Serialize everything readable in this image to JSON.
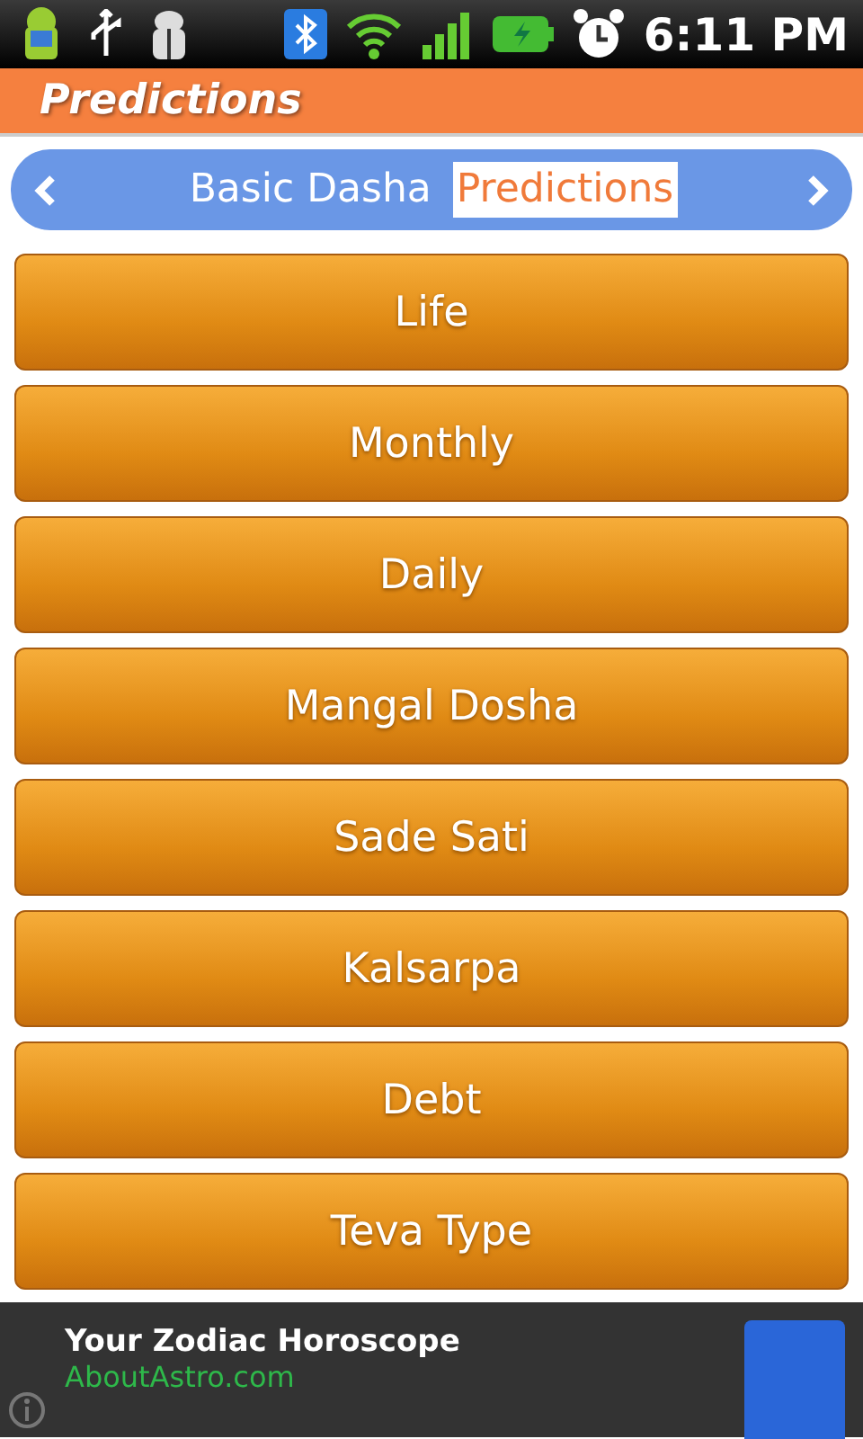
{
  "status_bar": {
    "time": "6:11 PM"
  },
  "header": {
    "title": "Predictions"
  },
  "tabs": [
    {
      "label": "Basic Dasha",
      "selected": false
    },
    {
      "label": "Predictions",
      "selected": true
    }
  ],
  "menu": [
    "Life",
    "Monthly",
    "Daily",
    "Mangal Dosha",
    "Sade Sati",
    "Kalsarpa",
    "Debt",
    "Teva Type"
  ],
  "ad": {
    "title": "Your Zodiac Horoscope",
    "url": "AboutAstro.com"
  }
}
